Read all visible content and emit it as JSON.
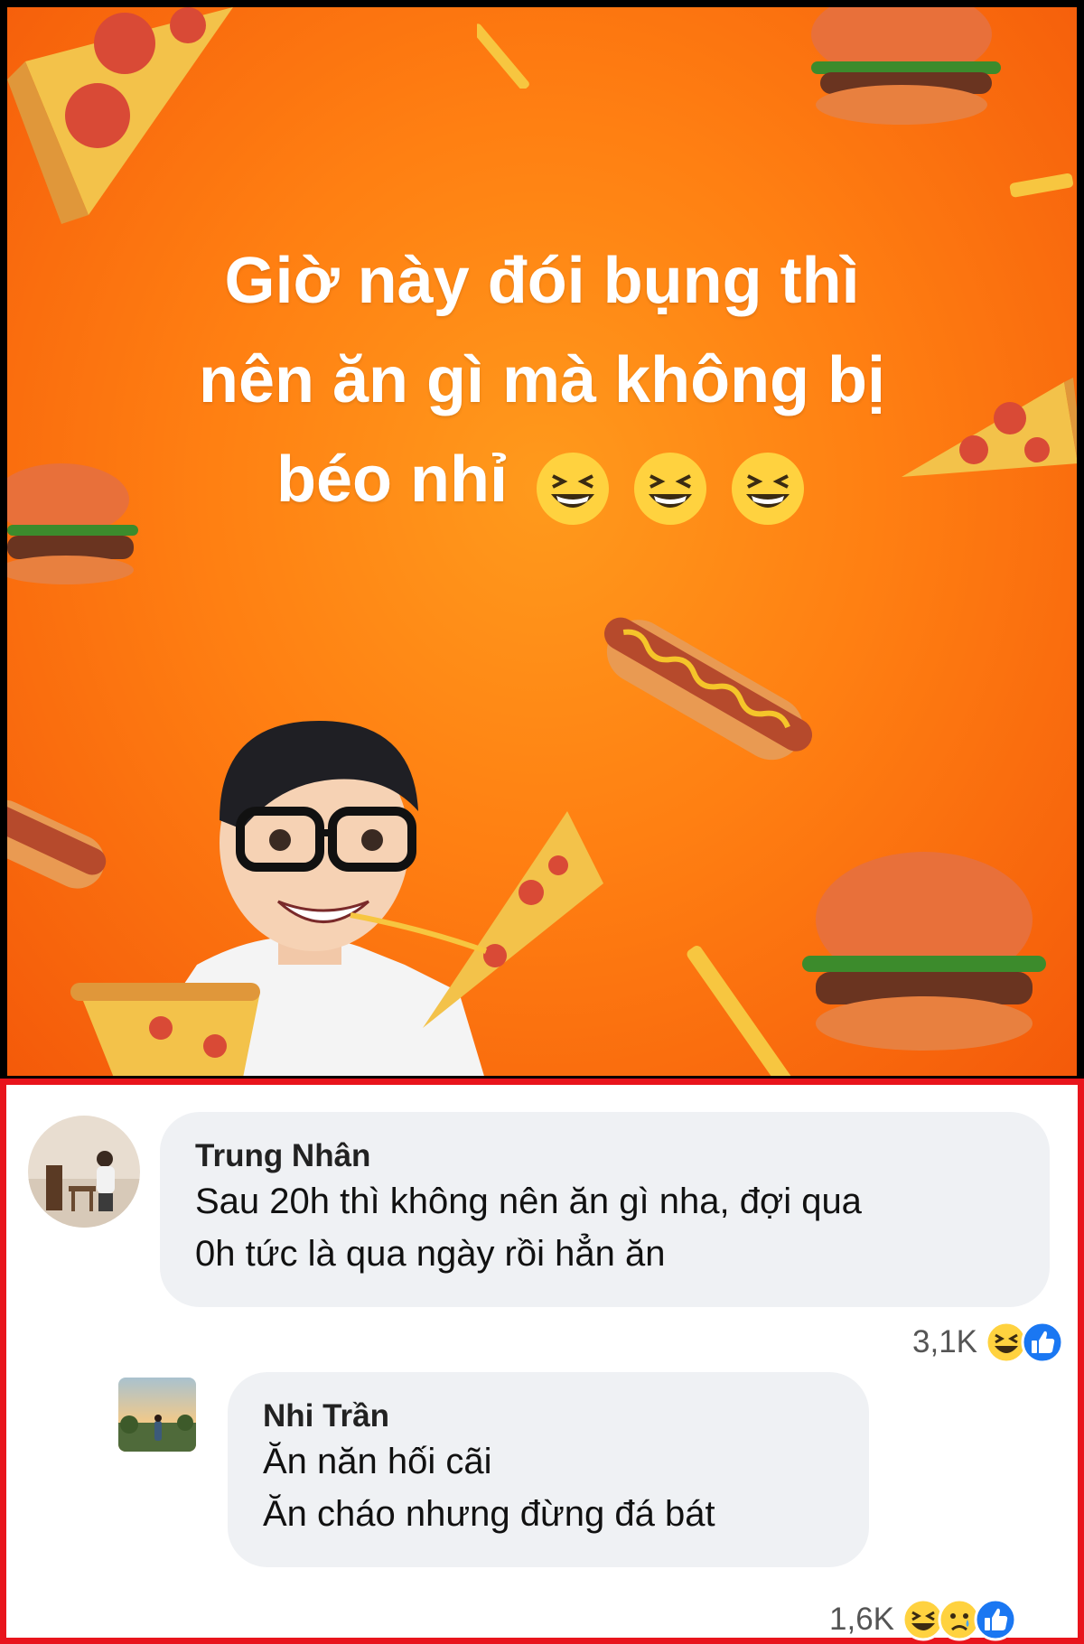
{
  "poster": {
    "line1": "Giờ này đói bụng thì",
    "line2": "nên ăn gì mà không bị",
    "line3": "béo nhỉ",
    "emojis": [
      "laughing-face-icon",
      "laughing-face-icon",
      "laughing-face-icon"
    ],
    "background_color": "#ff7f12"
  },
  "comments": [
    {
      "author": "Trung Nhân",
      "lines": [
        "Sau 20h thì không nên ăn gì nha, đợi qua",
        "0h tức là qua ngày rồi hẳn ăn"
      ],
      "reaction_count": "3,1K",
      "reactions": [
        "haha-icon",
        "like-icon"
      ]
    },
    {
      "author": "Nhi Trần",
      "lines": [
        "Ăn năn hối cãi",
        "Ăn cháo nhưng đừng đá bát"
      ],
      "reaction_count": "1,6K",
      "reactions": [
        "haha-icon",
        "sad-icon",
        "like-icon"
      ]
    }
  ],
  "highlight_border_color": "#e8141c"
}
